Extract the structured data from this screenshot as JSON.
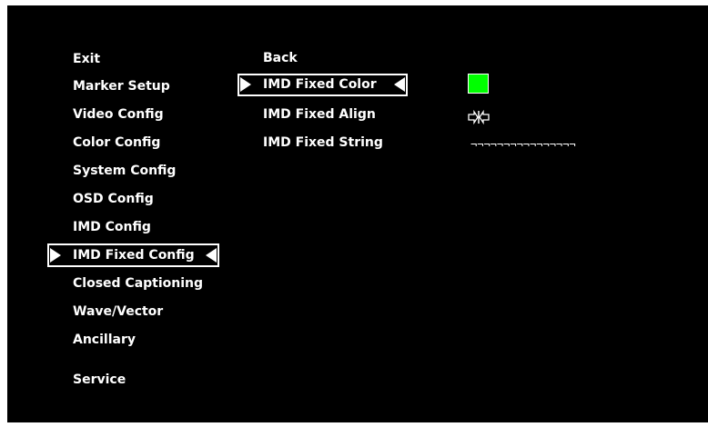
{
  "left_menu": {
    "items": [
      {
        "label": "Exit"
      },
      {
        "label": "Marker Setup"
      },
      {
        "label": "Video Config"
      },
      {
        "label": "Color Config"
      },
      {
        "label": "System Config"
      },
      {
        "label": "OSD Config"
      },
      {
        "label": "IMD Config"
      },
      {
        "label": "IMD Fixed Config",
        "selected": true
      },
      {
        "label": "Closed Captioning"
      },
      {
        "label": "Wave/Vector"
      },
      {
        "label": "Ancillary"
      },
      {
        "label": "Service"
      }
    ]
  },
  "sub_menu": {
    "items": [
      {
        "label": "Back"
      },
      {
        "label": "IMD Fixed Color",
        "selected": true
      },
      {
        "label": "IMD Fixed Align"
      },
      {
        "label": "IMD Fixed String"
      }
    ]
  },
  "values": {
    "fixed_color": "#00ff00",
    "fixed_align_icon": "center-align-icon",
    "fixed_string": "¬¬¬¬¬¬¬¬¬¬¬¬¬¬¬¬"
  },
  "colors": {
    "background": "#000000",
    "text": "#ffffff",
    "swatch": "#00ff00"
  }
}
